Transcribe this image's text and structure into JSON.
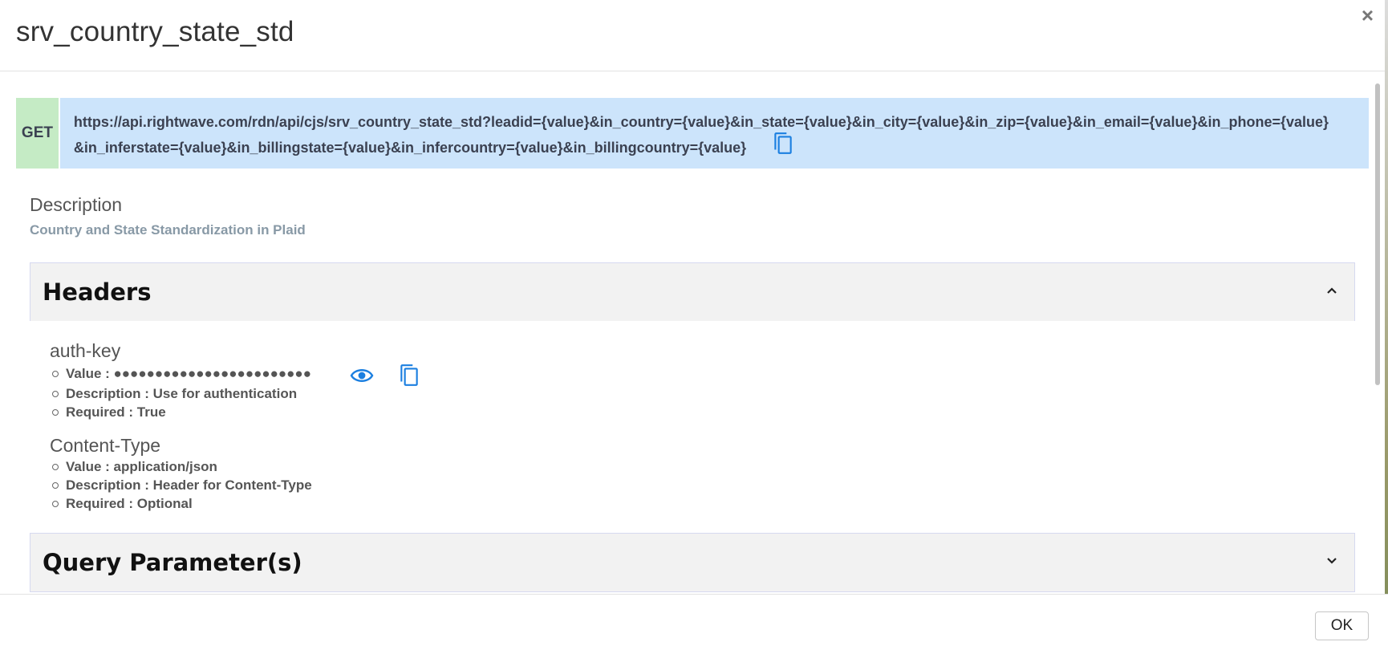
{
  "modal": {
    "title": "srv_country_state_std",
    "close_label": "×"
  },
  "endpoint": {
    "method": "GET",
    "url_line1": "https://api.rightwave.com/rdn/api/cjs/srv_country_state_std?leadid={value}&in_country={value}&in_state={value}&in_city={value}&in_zip={value}&in_email={value}&in_phone={value}",
    "url_line2": "&in_inferstate={value}&in_billingstate={value}&in_infercountry={value}&in_billingcountry={value}"
  },
  "description": {
    "title": "Description",
    "text": "Country and State Standardization in Plaid"
  },
  "headers_section": {
    "title": "Headers",
    "expanded": true,
    "items": [
      {
        "name": "auth-key",
        "value": "Value : ●●●●●●●●●●●●●●●●●●●●●●●●",
        "description": "Description : Use for authentication",
        "required": "Required : True"
      },
      {
        "name": "Content-Type",
        "value": "Value : application/json",
        "description": "Description : Header for Content-Type",
        "required": "Required : Optional"
      }
    ]
  },
  "query_section": {
    "title": "Query Parameter(s)",
    "expanded": false
  },
  "footer": {
    "ok_label": "OK"
  },
  "colors": {
    "method_bg": "#c5ebc5",
    "url_bg": "#cce4fb",
    "icon_blue": "#1b7fe0",
    "section_bg": "#f2f2f2"
  },
  "icons": {
    "copy": "copy-icon",
    "eye": "eye-icon",
    "chevron_up": "chevron-up-icon",
    "chevron_down": "chevron-down-icon",
    "close": "close-icon"
  }
}
